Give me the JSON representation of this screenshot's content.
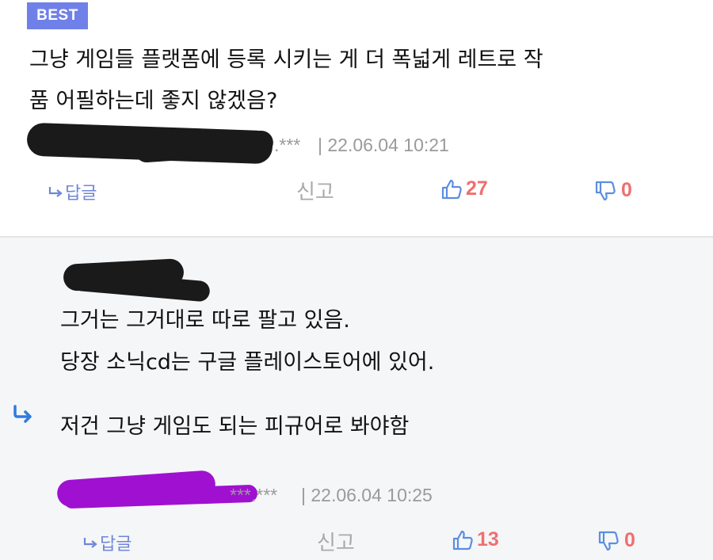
{
  "best": {
    "badge": "BEST",
    "text_lines": [
      "그냥 게임들 플랫폼에 등록 시키는 게 더 폭넓게 레트로 작",
      "품 어필하는데 좋지 않겠음?"
    ],
    "ip_masked": ".***",
    "datetime": "| 22.06.04 10:21",
    "actions": {
      "reply": "답글",
      "report": "신고",
      "likes": "27",
      "dislikes": "0"
    }
  },
  "reply": {
    "text_lines": [
      "그거는 그거대로 따로 팔고 있음.",
      "당장 소닉cd는 구글 플레이스토어에 있어.",
      "저건 그냥 게임도 되는 피규어로 봐야함"
    ],
    "ip_masked": "***.***",
    "datetime": "| 22.06.04 10:25",
    "actions": {
      "reply": "답글",
      "report": "신고",
      "likes": "13",
      "dislikes": "0"
    }
  },
  "colors": {
    "badge": "#6f80e8",
    "like_icon": "#5b8ee0",
    "count": "#ef6f6f",
    "redact_black": "#1a1a1a",
    "redact_purple": "#a010d0",
    "reply_arrow": "#2f7be0"
  },
  "icons": [
    "reply-arrow-icon",
    "thumbs-up-icon",
    "thumbs-down-icon",
    "nested-reply-arrow-icon"
  ]
}
